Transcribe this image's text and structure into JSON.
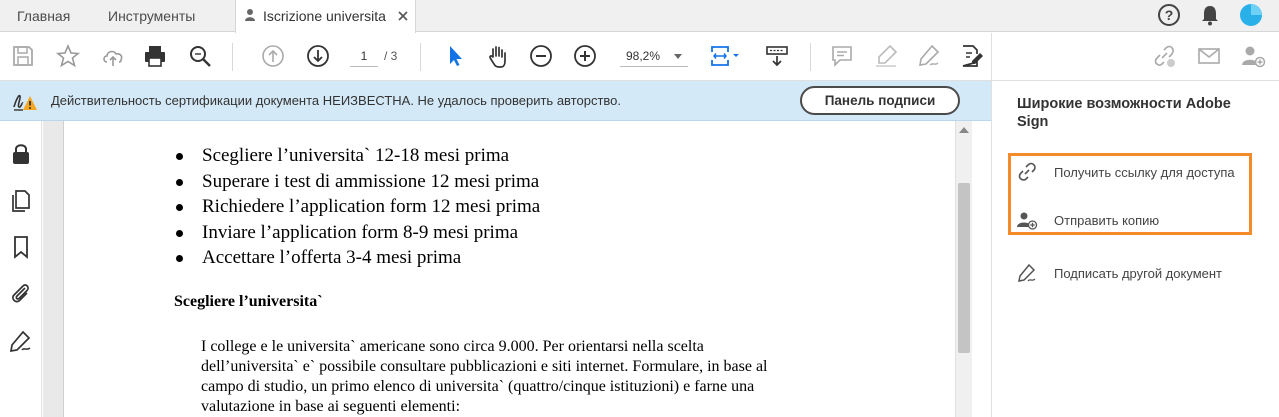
{
  "tabs": {
    "home": "Главная",
    "tools": "Инструменты",
    "document": "Iscrizione universita"
  },
  "toolbar": {
    "page_current": "1",
    "page_total": "/ 3",
    "zoom": "98,2%"
  },
  "notice": {
    "text": "Действительность сертификации документа НЕИЗВЕСТНА. Не удалось проверить авторство.",
    "button": "Панель подписи"
  },
  "document": {
    "bullets": [
      "Scegliere l’universita` 12-18 mesi prima",
      "Superare i test di ammissione 12 mesi prima",
      "Richiedere l’application form 12 mesi prima",
      "Inviare l’application form 8-9 mesi prima",
      "Accettare l’offerta 3-4 mesi prima"
    ],
    "heading": "Scegliere l’universita`",
    "paragraph": [
      "I college e le universita` americane sono circa 9.000. Per orientarsi nella scelta",
      "dell’universita` e` possibile consultare pubblicazioni e siti internet. Formulare, in base al",
      "campo di studio, un primo elenco di universita` (quattro/cinque istituzioni) e farne una",
      "valutazione in base ai seguenti elementi:"
    ]
  },
  "right_panel": {
    "title": "Широкие возможности Adobe Sign",
    "items": [
      {
        "label": "Получить ссылку для доступа",
        "icon": "link-icon"
      },
      {
        "label": "Отправить копию",
        "icon": "user-add-icon"
      },
      {
        "label": "Подписать другой документ",
        "icon": "sign-pen-icon"
      }
    ]
  },
  "colors": {
    "accent_blue": "#1473e6",
    "notice_bg": "#d4e9f7",
    "highlight_orange": "#f58b2b"
  }
}
